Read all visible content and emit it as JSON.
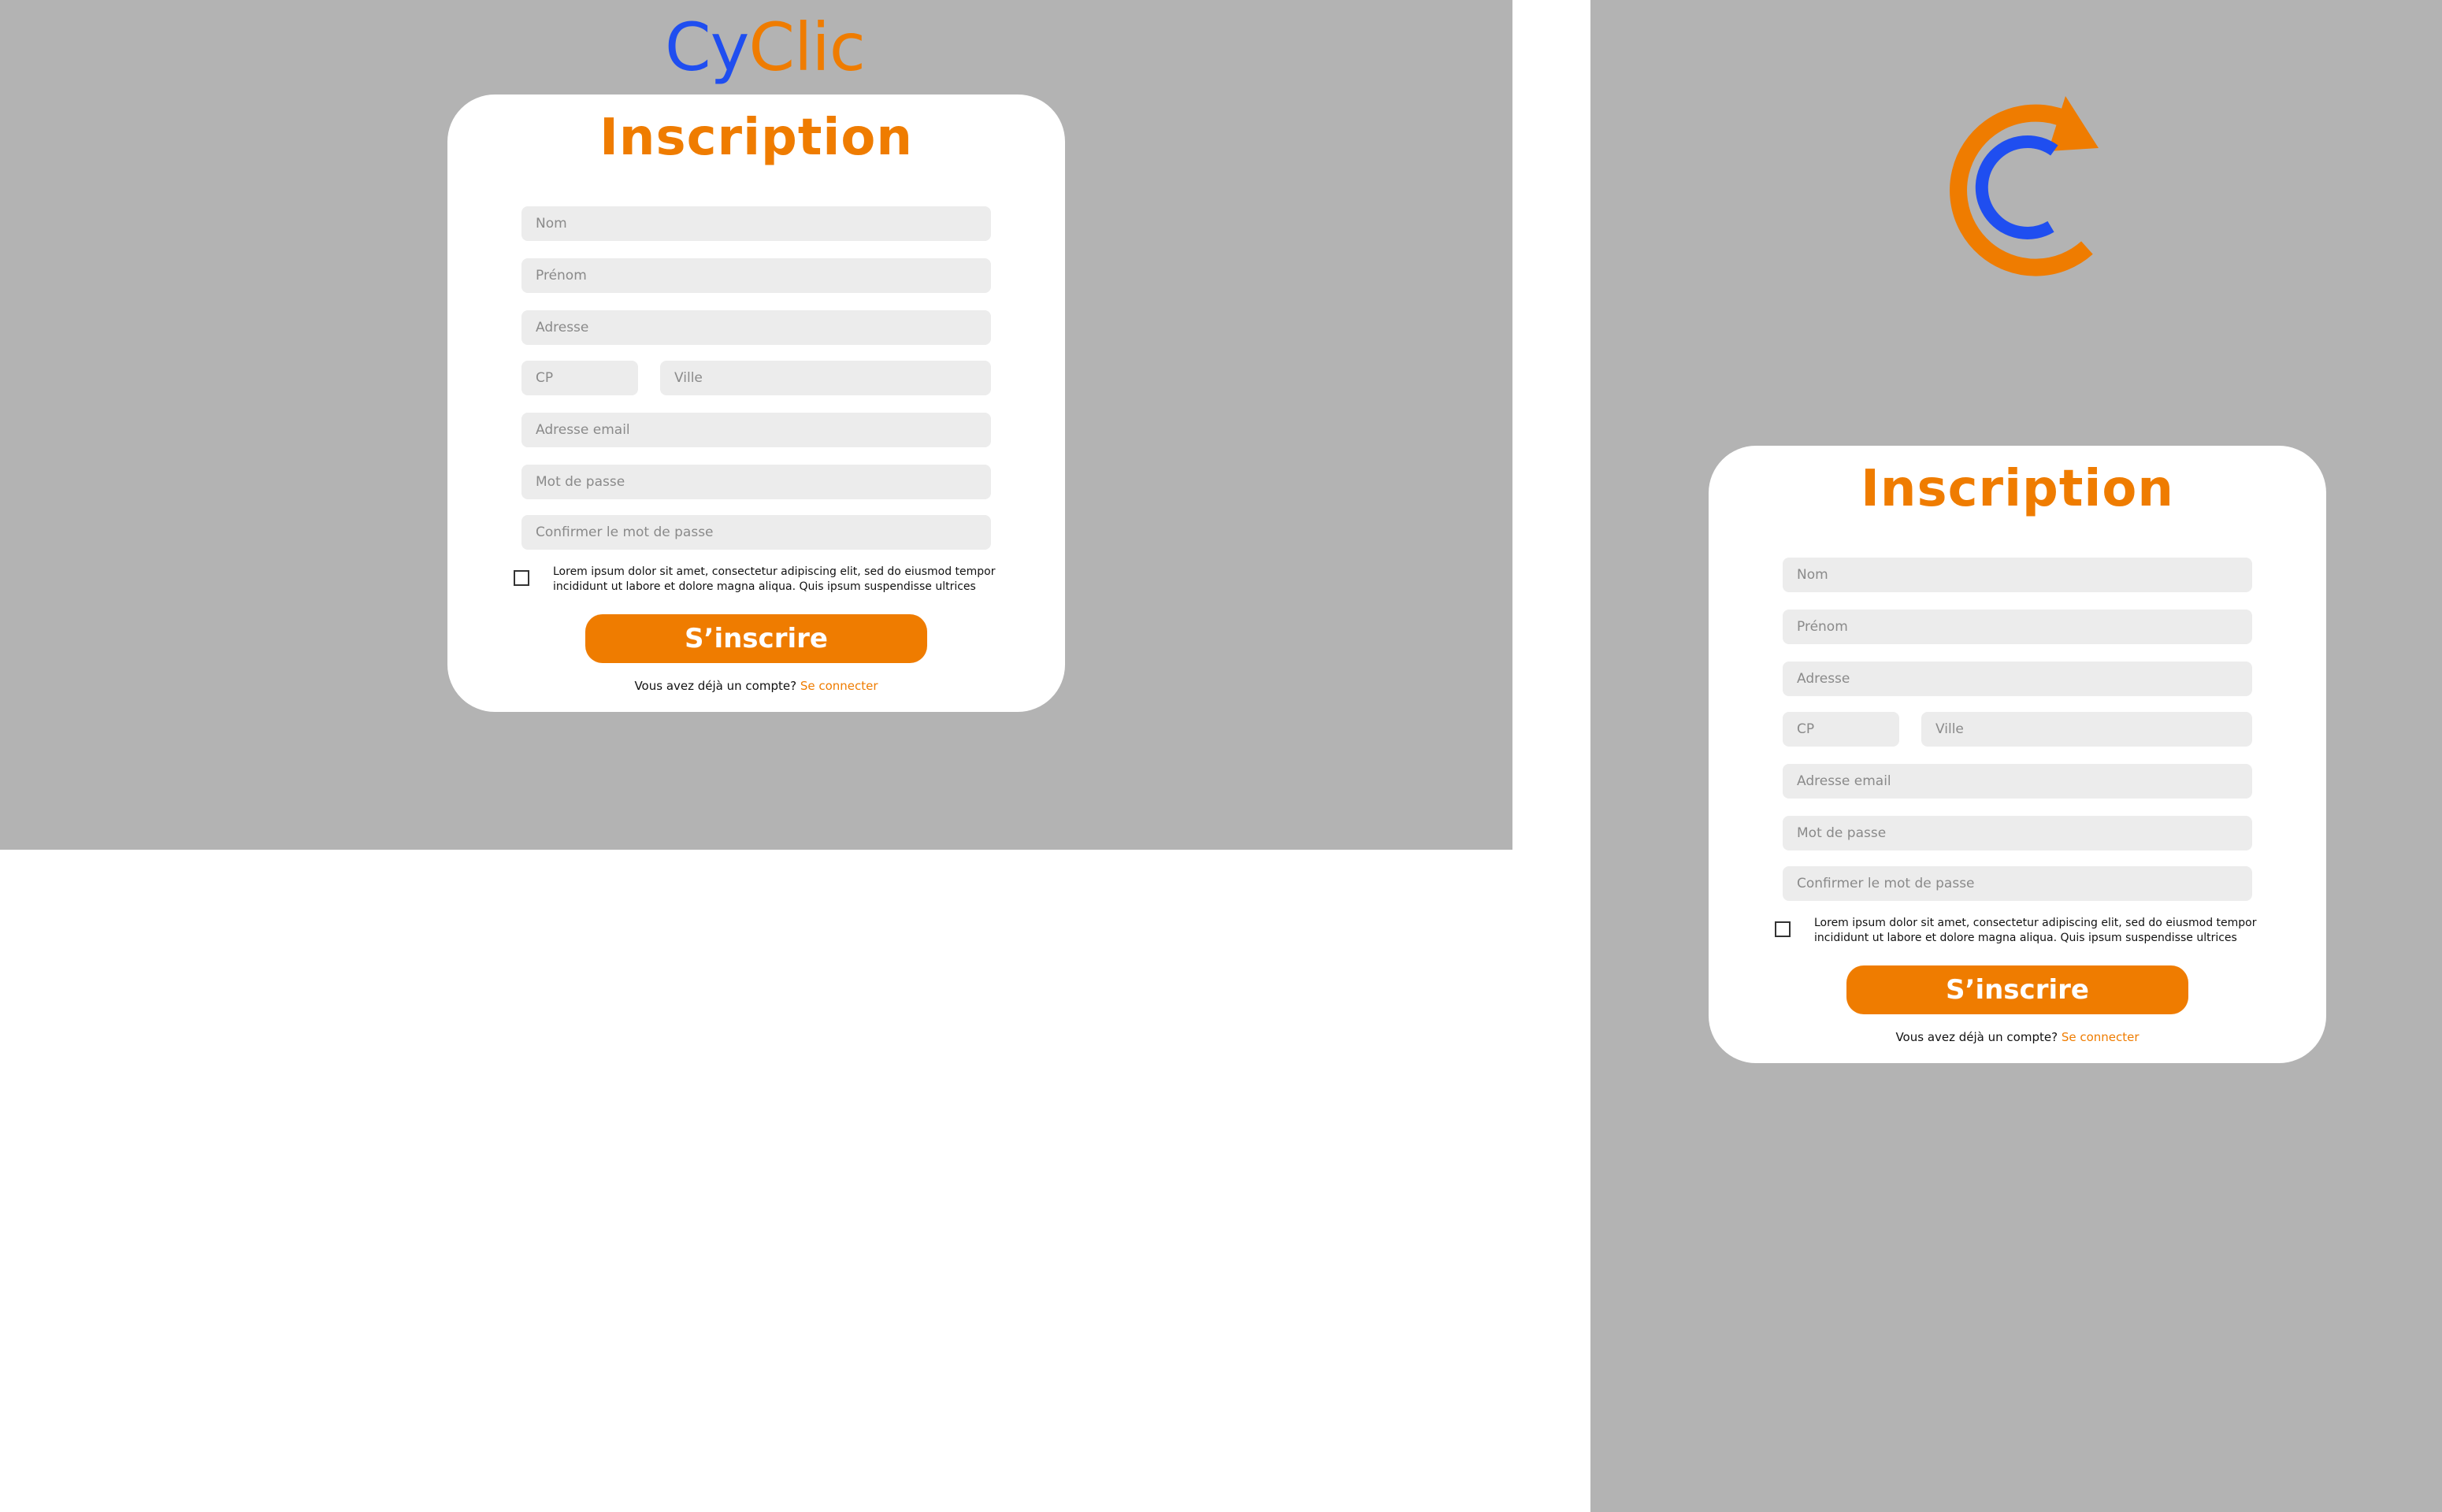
{
  "brand": {
    "logo_part1": "Cy",
    "logo_part2": "Clic",
    "blue": "#1f4ef0",
    "orange": "#ef7c00",
    "icon": "cyclic-refresh-logo-icon"
  },
  "colors": {
    "panel_background": "#b3b3b3",
    "card_background": "#ffffff",
    "field_background": "#ececec",
    "accent": "#ef7c00"
  },
  "form": {
    "title": "Inscription",
    "fields": {
      "nom": "Nom",
      "prenom": "Prénom",
      "adresse": "Adresse",
      "cp": "CP",
      "ville": "Ville",
      "email": "Adresse email",
      "password": "Mot de passe",
      "confirm_password": "Confirmer le mot de passe"
    },
    "terms_text": "Lorem ipsum dolor sit amet, consectetur adipiscing elit, sed do eiusmod tempor incididunt ut labore et dolore magna aliqua. Quis ipsum suspendisse ultrices",
    "terms_checked": false,
    "submit_label": "S’inscrire",
    "login_prompt": "Vous avez déjà un compte?",
    "login_link": "Se connecter"
  }
}
